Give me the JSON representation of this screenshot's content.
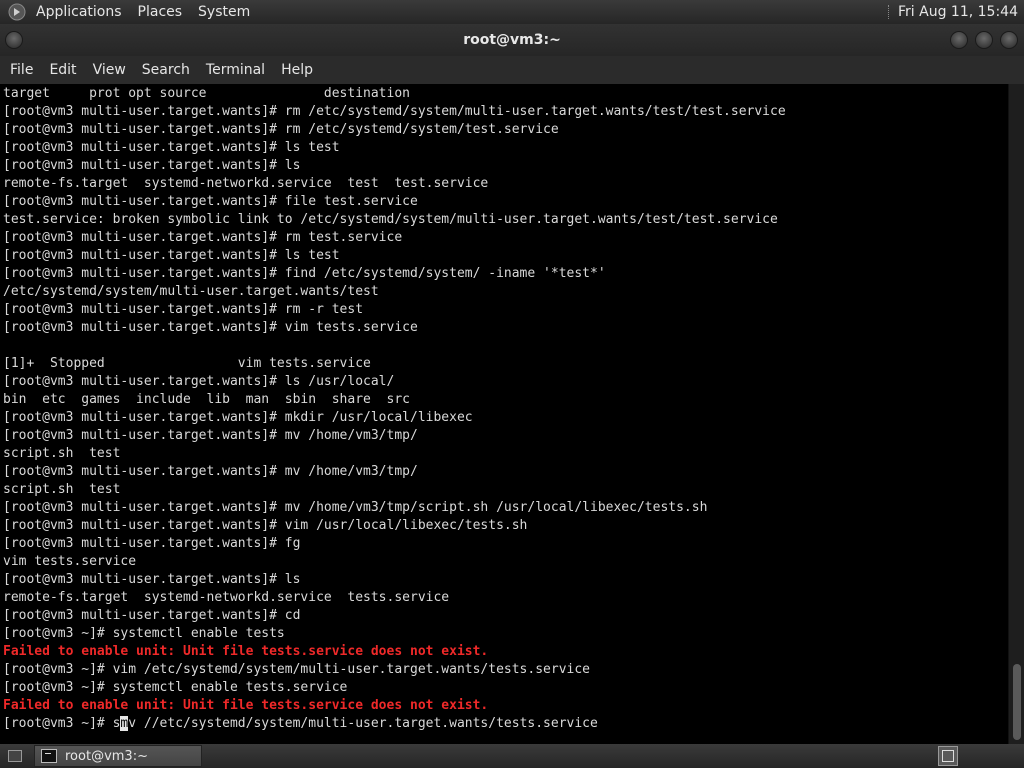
{
  "top_panel": {
    "menus": [
      "Applications",
      "Places",
      "System"
    ],
    "clock": "Fri Aug 11, 15:44",
    "apps_icon": "gnome-foot-icon"
  },
  "window": {
    "title": "root@vm3:~"
  },
  "menu_bar": [
    "File",
    "Edit",
    "View",
    "Search",
    "Terminal",
    "Help"
  ],
  "terminal": {
    "lines": [
      {
        "text": "target     prot opt source               destination",
        "type": "normal"
      },
      {
        "text": "[root@vm3 multi-user.target.wants]# rm /etc/systemd/system/multi-user.target.wants/test/test.service",
        "type": "normal"
      },
      {
        "text": "[root@vm3 multi-user.target.wants]# rm /etc/systemd/system/test.service",
        "type": "normal"
      },
      {
        "text": "[root@vm3 multi-user.target.wants]# ls test",
        "type": "normal"
      },
      {
        "text": "[root@vm3 multi-user.target.wants]# ls",
        "type": "normal"
      },
      {
        "text": "remote-fs.target  systemd-networkd.service  test  test.service",
        "type": "normal"
      },
      {
        "text": "[root@vm3 multi-user.target.wants]# file test.service",
        "type": "normal"
      },
      {
        "text": "test.service: broken symbolic link to /etc/systemd/system/multi-user.target.wants/test/test.service",
        "type": "normal"
      },
      {
        "text": "[root@vm3 multi-user.target.wants]# rm test.service",
        "type": "normal"
      },
      {
        "text": "[root@vm3 multi-user.target.wants]# ls test",
        "type": "normal"
      },
      {
        "text": "[root@vm3 multi-user.target.wants]# find /etc/systemd/system/ -iname '*test*'",
        "type": "normal"
      },
      {
        "text": "/etc/systemd/system/multi-user.target.wants/test",
        "type": "normal"
      },
      {
        "text": "[root@vm3 multi-user.target.wants]# rm -r test",
        "type": "normal"
      },
      {
        "text": "[root@vm3 multi-user.target.wants]# vim tests.service",
        "type": "normal"
      },
      {
        "text": "",
        "type": "normal"
      },
      {
        "text": "[1]+  Stopped                 vim tests.service",
        "type": "normal"
      },
      {
        "text": "[root@vm3 multi-user.target.wants]# ls /usr/local/",
        "type": "normal"
      },
      {
        "text": "bin  etc  games  include  lib  man  sbin  share  src",
        "type": "normal"
      },
      {
        "text": "[root@vm3 multi-user.target.wants]# mkdir /usr/local/libexec",
        "type": "normal"
      },
      {
        "text": "[root@vm3 multi-user.target.wants]# mv /home/vm3/tmp/",
        "type": "normal"
      },
      {
        "text": "script.sh  test",
        "type": "normal"
      },
      {
        "text": "[root@vm3 multi-user.target.wants]# mv /home/vm3/tmp/",
        "type": "normal"
      },
      {
        "text": "script.sh  test",
        "type": "normal"
      },
      {
        "text": "[root@vm3 multi-user.target.wants]# mv /home/vm3/tmp/script.sh /usr/local/libexec/tests.sh",
        "type": "normal"
      },
      {
        "text": "[root@vm3 multi-user.target.wants]# vim /usr/local/libexec/tests.sh",
        "type": "normal"
      },
      {
        "text": "[root@vm3 multi-user.target.wants]# fg",
        "type": "normal"
      },
      {
        "text": "vim tests.service",
        "type": "normal"
      },
      {
        "text": "[root@vm3 multi-user.target.wants]# ls",
        "type": "normal"
      },
      {
        "text": "remote-fs.target  systemd-networkd.service  tests.service",
        "type": "normal"
      },
      {
        "text": "[root@vm3 multi-user.target.wants]# cd",
        "type": "normal"
      },
      {
        "text": "[root@vm3 ~]# systemctl enable tests",
        "type": "normal"
      },
      {
        "text": "Failed to enable unit: Unit file tests.service does not exist.",
        "type": "err"
      },
      {
        "text": "[root@vm3 ~]# vim /etc/systemd/system/multi-user.target.wants/tests.service",
        "type": "normal"
      },
      {
        "text": "[root@vm3 ~]# systemctl enable tests.service",
        "type": "normal"
      },
      {
        "text": "Failed to enable unit: Unit file tests.service does not exist.",
        "type": "err"
      }
    ],
    "prompt_line": {
      "before_cursor": "[root@vm3 ~]# s",
      "cursor_char": "m",
      "after_cursor": "v //etc/systemd/system/multi-user.target.wants/tests.service"
    }
  },
  "bottom_panel": {
    "task_label": "root@vm3:~",
    "task_icon": "terminal-icon"
  }
}
